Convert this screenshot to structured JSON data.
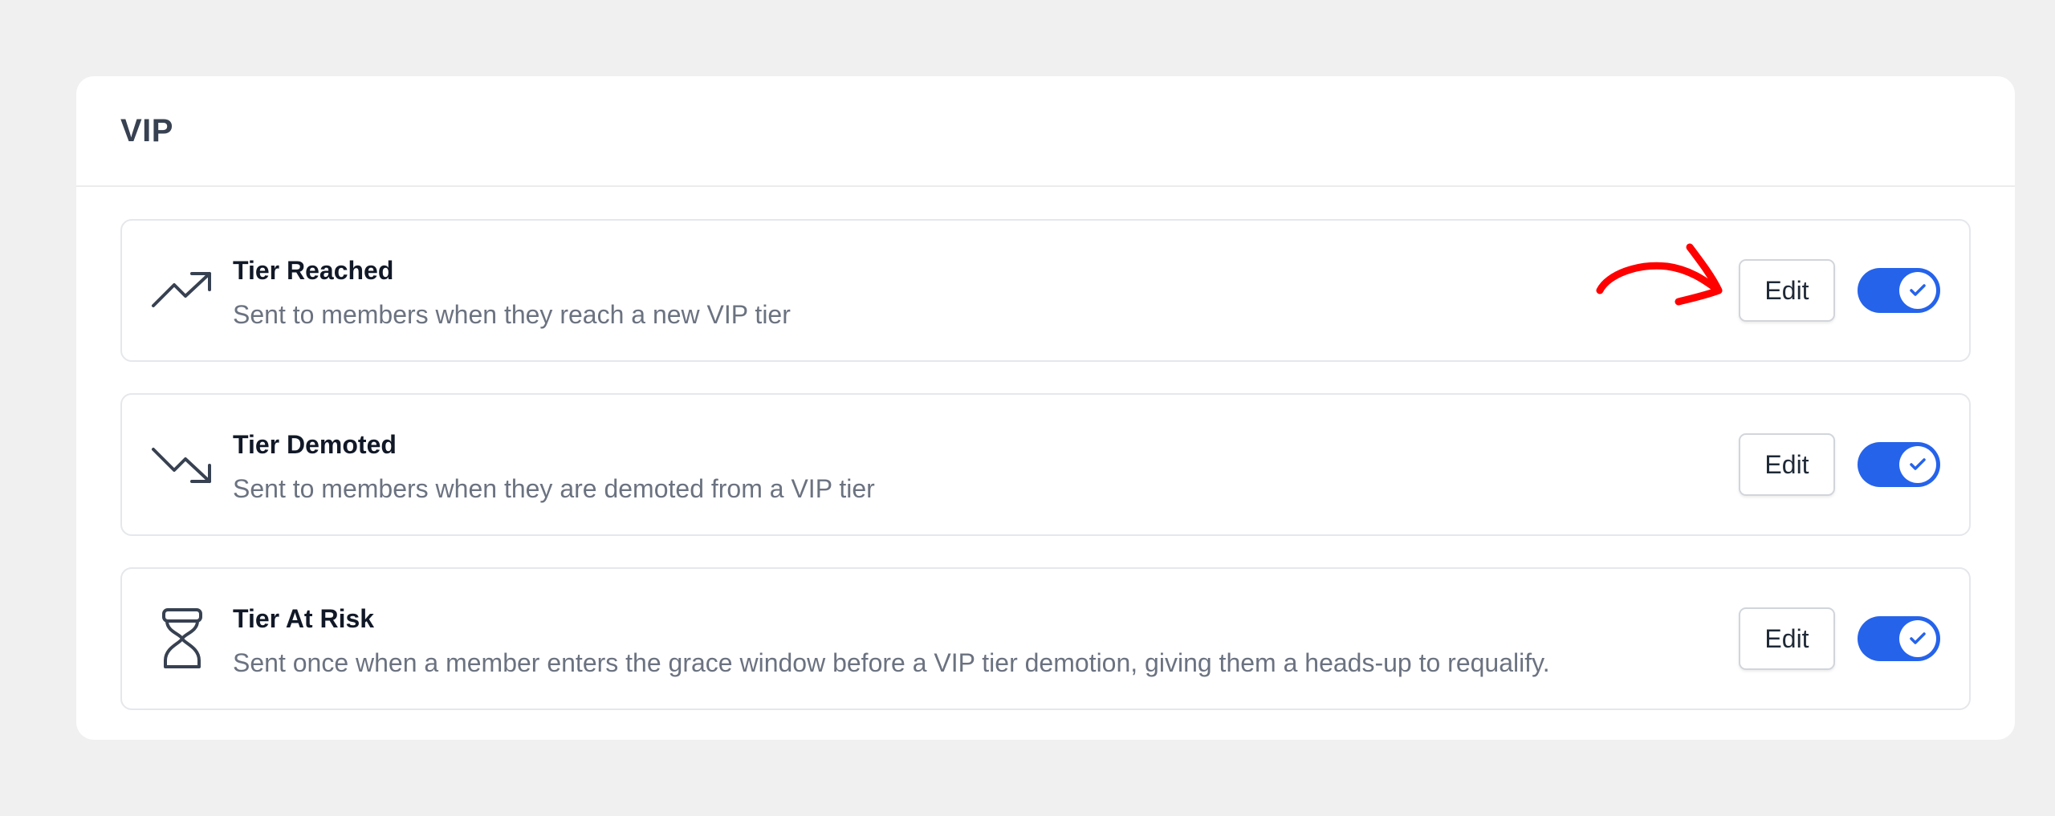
{
  "card": {
    "title": "VIP"
  },
  "rows": [
    {
      "icon": "trending-up-icon",
      "title": "Tier Reached",
      "description": "Sent to members when they reach a new VIP tier",
      "edit_label": "Edit",
      "enabled": true
    },
    {
      "icon": "trending-down-icon",
      "title": "Tier Demoted",
      "description": "Sent to members when they are demoted from a VIP tier",
      "edit_label": "Edit",
      "enabled": true
    },
    {
      "icon": "hourglass-icon",
      "title": "Tier At Risk",
      "description": "Sent once when a member enters the grace window before a VIP tier demotion, giving them a heads-up to requalify.",
      "edit_label": "Edit",
      "enabled": true
    }
  ],
  "colors": {
    "background": "#f0f0f0",
    "card": "#ffffff",
    "toggle_on": "#2563eb",
    "annotation": "#ff0000",
    "muted_text": "#6b7280"
  }
}
